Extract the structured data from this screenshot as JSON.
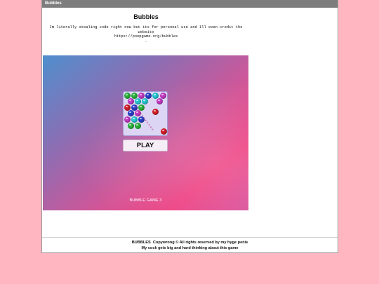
{
  "window": {
    "title": "Bubbles"
  },
  "page": {
    "heading": "Bubbles",
    "intro_lines": [
      "Im literally stealing code right now but its for personal use and Ill even credit the",
      "website",
      "https://poopgame.org/bubbles",
      "."
    ]
  },
  "game": {
    "play_label": "PLAY",
    "caption": "BUBBLE GAME 3",
    "thumbnail_icon": "bubble-shooter-thumbnail"
  },
  "footer": {
    "brand": "BUBBLES",
    "line1": "Copywrong © All rights reserved by my hyge penis",
    "line2": "My cock gets big and hard thinking about this game"
  },
  "colors": {
    "page_background": "#ffb6c1",
    "titlebar": "#7d7d7d",
    "bubble_green": "#2bb23a",
    "bubble_cyan": "#27c7d3",
    "bubble_magenta": "#c43ac4",
    "bubble_blue": "#2a3fc9",
    "bubble_red": "#d31f2a"
  }
}
